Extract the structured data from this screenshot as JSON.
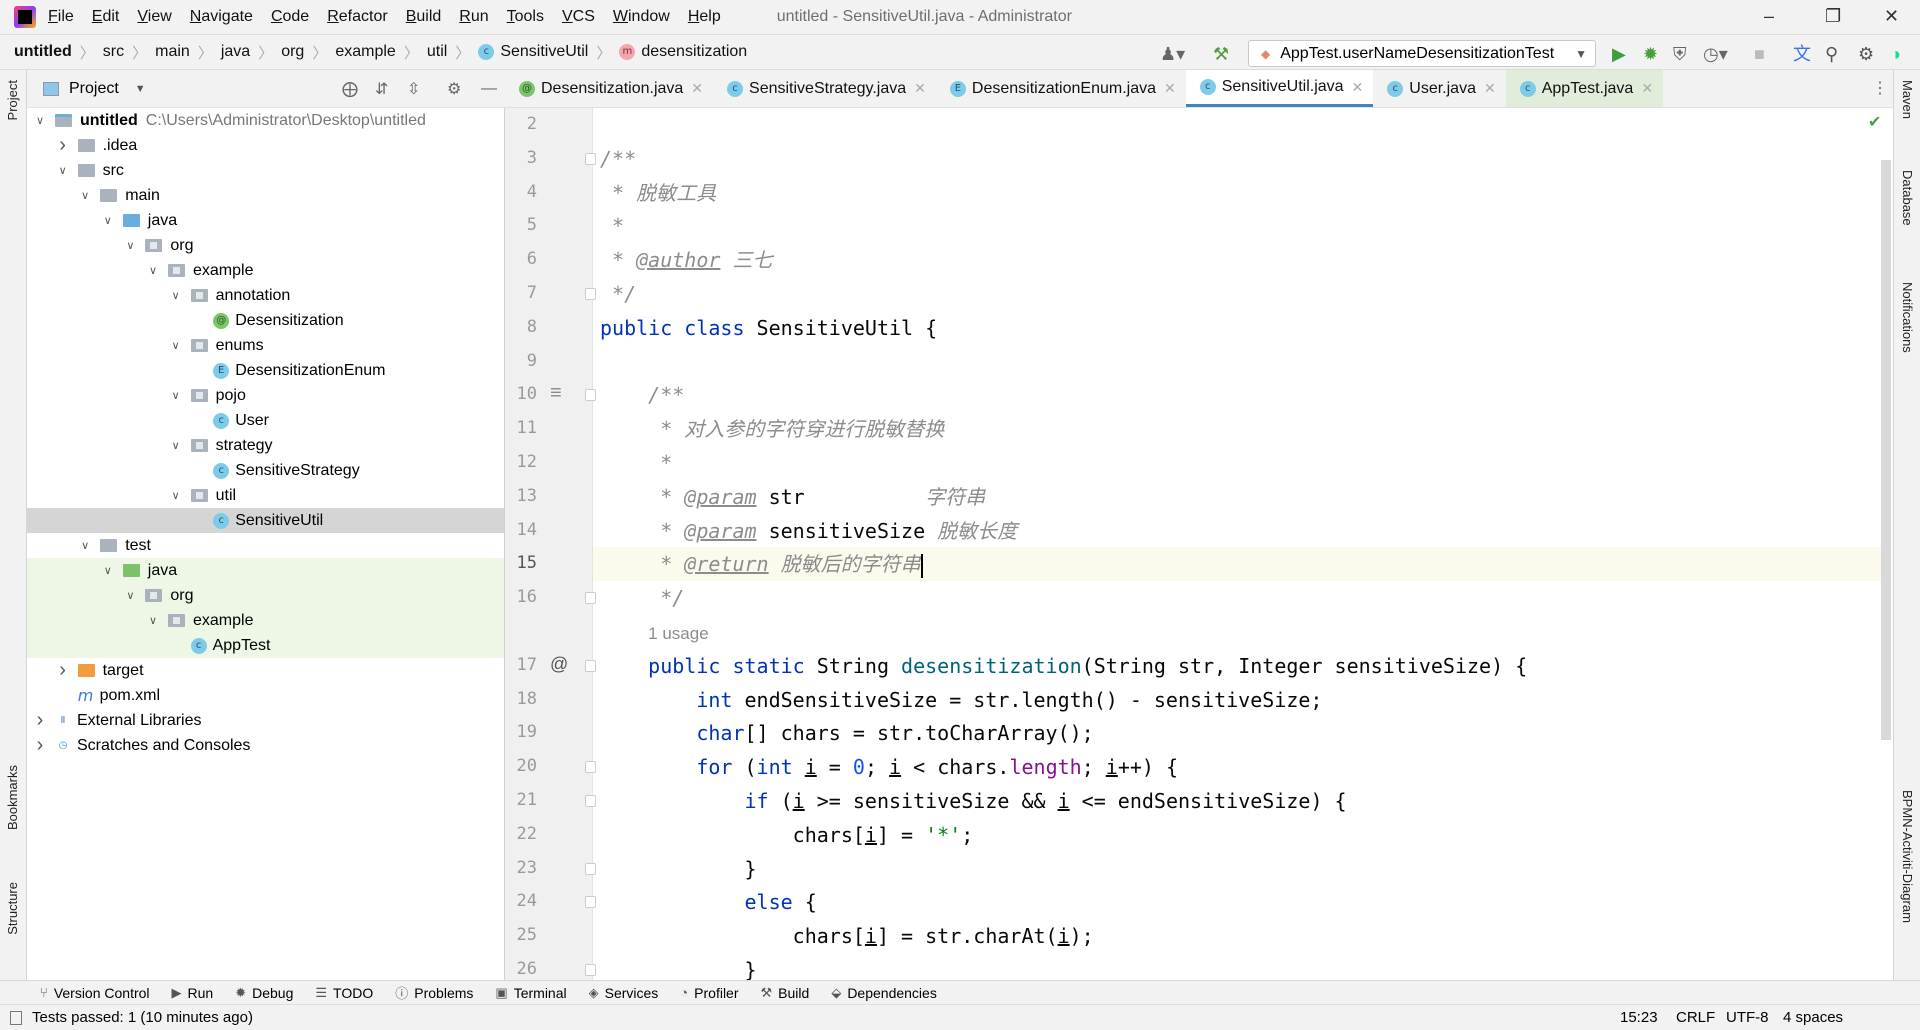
{
  "titlebar": {
    "menus": [
      "File",
      "Edit",
      "View",
      "Navigate",
      "Code",
      "Refactor",
      "Build",
      "Run",
      "Tools",
      "VCS",
      "Window",
      "Help"
    ],
    "title": "untitled - SensitiveUtil.java - Administrator"
  },
  "breadcrumb": {
    "items": [
      "untitled",
      "src",
      "main",
      "java",
      "org",
      "example",
      "util",
      "SensitiveUtil",
      "desensitization"
    ]
  },
  "toolbar": {
    "run_config": "AppTest.userNameDesensitizationTest"
  },
  "project_panel": {
    "title": "Project",
    "tree": [
      {
        "level": 0,
        "arrow": "open",
        "icon": "module",
        "label": "untitled",
        "bold": true,
        "path": "C:\\Users\\Administrator\\Desktop\\untitled"
      },
      {
        "level": 1,
        "arrow": "closed",
        "icon": "folder",
        "label": ".idea"
      },
      {
        "level": 1,
        "arrow": "open",
        "icon": "folder",
        "label": "src"
      },
      {
        "level": 2,
        "arrow": "open",
        "icon": "folder",
        "label": "main"
      },
      {
        "level": 3,
        "arrow": "open",
        "icon": "source-folder",
        "label": "java"
      },
      {
        "level": 4,
        "arrow": "open",
        "icon": "package",
        "label": "org"
      },
      {
        "level": 5,
        "arrow": "open",
        "icon": "package",
        "label": "example"
      },
      {
        "level": 6,
        "arrow": "open",
        "icon": "package",
        "label": "annotation"
      },
      {
        "level": 7,
        "arrow": "none",
        "icon": "annotation",
        "label": "Desensitization"
      },
      {
        "level": 6,
        "arrow": "open",
        "icon": "package",
        "label": "enums"
      },
      {
        "level": 7,
        "arrow": "none",
        "icon": "enum",
        "label": "DesensitizationEnum"
      },
      {
        "level": 6,
        "arrow": "open",
        "icon": "package",
        "label": "pojo"
      },
      {
        "level": 7,
        "arrow": "none",
        "icon": "class",
        "label": "User"
      },
      {
        "level": 6,
        "arrow": "open",
        "icon": "package",
        "label": "strategy"
      },
      {
        "level": 7,
        "arrow": "none",
        "icon": "class",
        "label": "SensitiveStrategy"
      },
      {
        "level": 6,
        "arrow": "open",
        "icon": "package",
        "label": "util"
      },
      {
        "level": 7,
        "arrow": "none",
        "icon": "class",
        "label": "SensitiveUtil",
        "selected": true
      },
      {
        "level": 2,
        "arrow": "open",
        "icon": "folder",
        "label": "test"
      },
      {
        "level": 3,
        "arrow": "open",
        "icon": "test-folder",
        "label": "java",
        "test": true
      },
      {
        "level": 4,
        "arrow": "open",
        "icon": "package",
        "label": "org",
        "test": true
      },
      {
        "level": 5,
        "arrow": "open",
        "icon": "package",
        "label": "example",
        "test": true
      },
      {
        "level": 6,
        "arrow": "none",
        "icon": "test-class",
        "label": "AppTest",
        "test": true
      },
      {
        "level": 1,
        "arrow": "closed",
        "icon": "excluded-folder",
        "label": "target"
      },
      {
        "level": 1,
        "arrow": "none",
        "icon": "maven",
        "label": "pom.xml"
      },
      {
        "level": 0,
        "arrow": "closed",
        "icon": "libraries",
        "label": "External Libraries"
      },
      {
        "level": 0,
        "arrow": "closed",
        "icon": "scratches",
        "label": "Scratches and Consoles"
      }
    ]
  },
  "tabs": [
    {
      "label": "Desensitization.java",
      "icon": "annotation"
    },
    {
      "label": "SensitiveStrategy.java",
      "icon": "class"
    },
    {
      "label": "DesensitizationEnum.java",
      "icon": "enum"
    },
    {
      "label": "SensitiveUtil.java",
      "icon": "class",
      "active": true
    },
    {
      "label": "User.java",
      "icon": "class"
    },
    {
      "label": "AppTest.java",
      "icon": "test-class",
      "test": true
    }
  ],
  "editor": {
    "caret": "15:23",
    "lines": [
      {
        "n": "2",
        "segs": []
      },
      {
        "n": "3",
        "segs": [
          [
            "/**",
            "cm"
          ]
        ]
      },
      {
        "n": "4",
        "segs": [
          [
            " * 脱敏工具",
            "cm"
          ]
        ]
      },
      {
        "n": "5",
        "segs": [
          [
            " *",
            "cm"
          ]
        ]
      },
      {
        "n": "6",
        "segs": [
          [
            " * ",
            "cm"
          ],
          [
            "@author",
            "tag"
          ],
          [
            " 三七",
            "cm"
          ]
        ]
      },
      {
        "n": "7",
        "segs": [
          [
            " */",
            "cm"
          ]
        ]
      },
      {
        "n": "8",
        "segs": [
          [
            "public class ",
            "kw"
          ],
          [
            "SensitiveUtil {",
            ""
          ]
        ]
      },
      {
        "n": "9",
        "segs": []
      },
      {
        "n": "10",
        "segs": [
          [
            "    /**",
            "cm"
          ]
        ]
      },
      {
        "n": "11",
        "segs": [
          [
            "     * 对入参的字符穿进行脱敏替换",
            "cm"
          ]
        ]
      },
      {
        "n": "12",
        "segs": [
          [
            "     *",
            "cm"
          ]
        ]
      },
      {
        "n": "13",
        "segs": [
          [
            "     * ",
            "cm"
          ],
          [
            "@param",
            "tag"
          ],
          [
            " str",
            ""
          ],
          [
            "          字符串",
            "cm"
          ]
        ]
      },
      {
        "n": "14",
        "segs": [
          [
            "     * ",
            "cm"
          ],
          [
            "@param",
            "tag"
          ],
          [
            " sensitiveSize",
            ""
          ],
          [
            " 脱敏长度",
            "cm"
          ]
        ]
      },
      {
        "n": "15",
        "segs": [
          [
            "     * ",
            "cm"
          ],
          [
            "@return",
            "tag"
          ],
          [
            " 脱敏后的字符串",
            "cm"
          ]
        ],
        "current": true
      },
      {
        "n": "16",
        "segs": [
          [
            "     */",
            "cm"
          ]
        ]
      },
      {
        "n": "",
        "segs": [
          [
            "    ",
            ""
          ],
          [
            "1 usage",
            "inlay"
          ]
        ]
      },
      {
        "n": "17",
        "segs": [
          [
            "    public static ",
            "kw"
          ],
          [
            "String ",
            ""
          ],
          [
            "desensitization",
            "fn"
          ],
          [
            "(String str, Integer sensitiveSize) {",
            ""
          ]
        ]
      },
      {
        "n": "18",
        "segs": [
          [
            "        int ",
            "kw"
          ],
          [
            "endSensitiveSize = str.length() - sensitiveSize;",
            ""
          ]
        ]
      },
      {
        "n": "19",
        "segs": [
          [
            "        char",
            "kw"
          ],
          [
            "[] chars = str.toCharArray();",
            ""
          ]
        ]
      },
      {
        "n": "20",
        "segs": [
          [
            "        for ",
            "kw"
          ],
          [
            "(",
            ""
          ],
          [
            "int ",
            "kw"
          ],
          [
            "i",
            "var"
          ],
          [
            " = ",
            ""
          ],
          [
            "0",
            "num"
          ],
          [
            "; ",
            ""
          ],
          [
            "i",
            "var"
          ],
          [
            " < chars.",
            ""
          ],
          [
            "length",
            "fld"
          ],
          [
            "; ",
            ""
          ],
          [
            "i",
            "var"
          ],
          [
            "++) {",
            ""
          ]
        ]
      },
      {
        "n": "21",
        "segs": [
          [
            "            if ",
            "kw"
          ],
          [
            "(",
            ""
          ],
          [
            "i",
            "var"
          ],
          [
            " >= sensitiveSize && ",
            ""
          ],
          [
            "i",
            "var"
          ],
          [
            " <= endSensitiveSize) {",
            ""
          ]
        ]
      },
      {
        "n": "22",
        "segs": [
          [
            "                chars[",
            ""
          ],
          [
            "i",
            "var"
          ],
          [
            "] = ",
            ""
          ],
          [
            "'*'",
            "str"
          ],
          [
            ";",
            ""
          ]
        ]
      },
      {
        "n": "23",
        "segs": [
          [
            "            }",
            ""
          ]
        ]
      },
      {
        "n": "24",
        "segs": [
          [
            "            else ",
            "kw"
          ],
          [
            "{",
            ""
          ]
        ]
      },
      {
        "n": "25",
        "segs": [
          [
            "                chars[",
            ""
          ],
          [
            "i",
            "var"
          ],
          [
            "] = str.charAt(",
            ""
          ],
          [
            "i",
            "var"
          ],
          [
            ");",
            ""
          ]
        ]
      },
      {
        "n": "26",
        "segs": [
          [
            "            }",
            ""
          ]
        ]
      }
    ]
  },
  "left_strip": {
    "project": "Project",
    "bookmarks": "Bookmarks",
    "structure": "Structure"
  },
  "right_strip": {
    "maven": "Maven",
    "database": "Database",
    "notifications": "Notifications",
    "bpmn": "BPMN-Activiti-Diagram"
  },
  "tool_windows": [
    "Version Control",
    "Run",
    "Debug",
    "TODO",
    "Problems",
    "Terminal",
    "Services",
    "Profiler",
    "Build",
    "Dependencies"
  ],
  "status": {
    "message": "Tests passed: 1 (10 minutes ago)",
    "position": "15:23",
    "line_sep": "CRLF",
    "encoding": "UTF-8",
    "indent": "4 spaces"
  }
}
